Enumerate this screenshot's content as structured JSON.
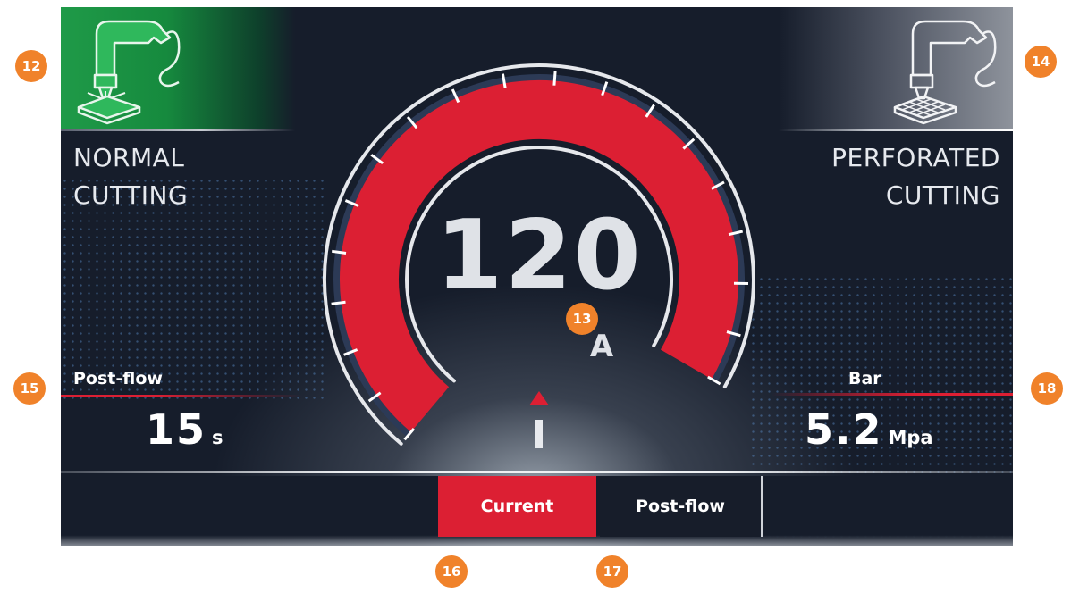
{
  "modes": {
    "normal": {
      "line1": "NORMAL",
      "line2": "CUTTING",
      "icon": "torch-normal-cutting-icon",
      "active": true
    },
    "perforated": {
      "line1": "PERFORATED",
      "line2": "CUTTING",
      "icon": "torch-perforated-cutting-icon",
      "active": false
    }
  },
  "gauge": {
    "value": "120",
    "unit": "A",
    "fill_fraction": 1.0,
    "pointer_label": "I"
  },
  "params": {
    "left": {
      "label": "Post-flow",
      "value": "15",
      "unit": "s"
    },
    "right": {
      "label": "Bar",
      "value": "5.2",
      "unit": "Mpa"
    }
  },
  "tabs": [
    {
      "label": "Current",
      "active": true
    },
    {
      "label": "Post-flow",
      "active": false
    }
  ],
  "callouts": {
    "c12": "12",
    "c13": "13",
    "c14": "14",
    "c15": "15",
    "c16": "16",
    "c17": "17",
    "c18": "18"
  },
  "colors": {
    "accent_red": "#dc1f33",
    "active_green": "#1f9a48",
    "callout_orange": "#f0822a",
    "background": "#161d2b"
  }
}
